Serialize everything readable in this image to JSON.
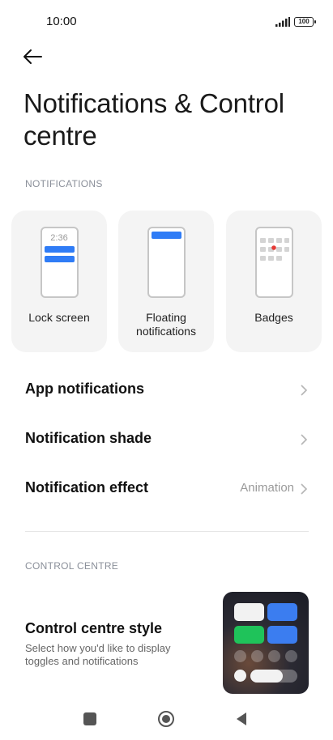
{
  "status_bar": {
    "time": "10:00",
    "battery": "100"
  },
  "header": {
    "title": "Notifications & Control centre"
  },
  "notifications": {
    "section_label": "NOTIFICATIONS",
    "cards": [
      {
        "label": "Lock screen",
        "preview_time": "2:36",
        "icon": "lock-screen-icon"
      },
      {
        "label": "Floating notifications",
        "icon": "floating-notifications-icon"
      },
      {
        "label": "Badges",
        "icon": "badges-icon"
      }
    ],
    "rows": [
      {
        "label": "App notifications",
        "value": ""
      },
      {
        "label": "Notification shade",
        "value": ""
      },
      {
        "label": "Notification effect",
        "value": "Animation"
      }
    ]
  },
  "control_centre": {
    "section_label": "CONTROL CENTRE",
    "style_title": "Control centre style",
    "style_desc": "Select how you'd like to display toggles and notifications"
  },
  "colors": {
    "accent": "#2f7cf6",
    "badge_dot": "#e53935",
    "card_bg": "#f4f4f4",
    "section_label": "#8a8f99"
  },
  "nav": {
    "buttons": [
      "recents-icon",
      "home-icon",
      "back-icon"
    ]
  }
}
